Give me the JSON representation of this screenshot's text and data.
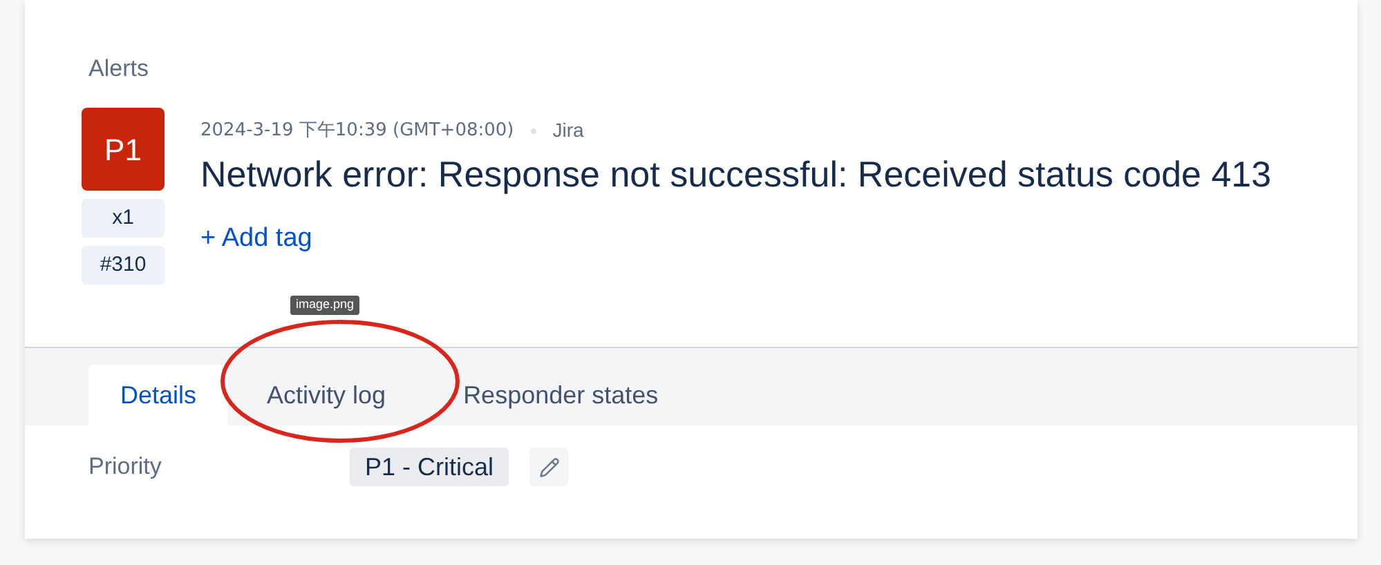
{
  "header": {
    "title": "Alerts"
  },
  "alert": {
    "priority": "P1",
    "count": "x1",
    "number": "#310",
    "timestamp": "2024-3-19 下午10:39 (GMT+08:00)",
    "source": "Jira",
    "message": "Network error: Response not successful: Received status code 413",
    "add_tag": "+ Add tag"
  },
  "tooltip": "image.png",
  "tabs": [
    {
      "label": "Details",
      "selected": true
    },
    {
      "label": "Activity log",
      "selected": false
    },
    {
      "label": "Responder states",
      "selected": false
    }
  ],
  "details": [
    {
      "label": "Priority",
      "value": "P1 - Critical"
    }
  ]
}
